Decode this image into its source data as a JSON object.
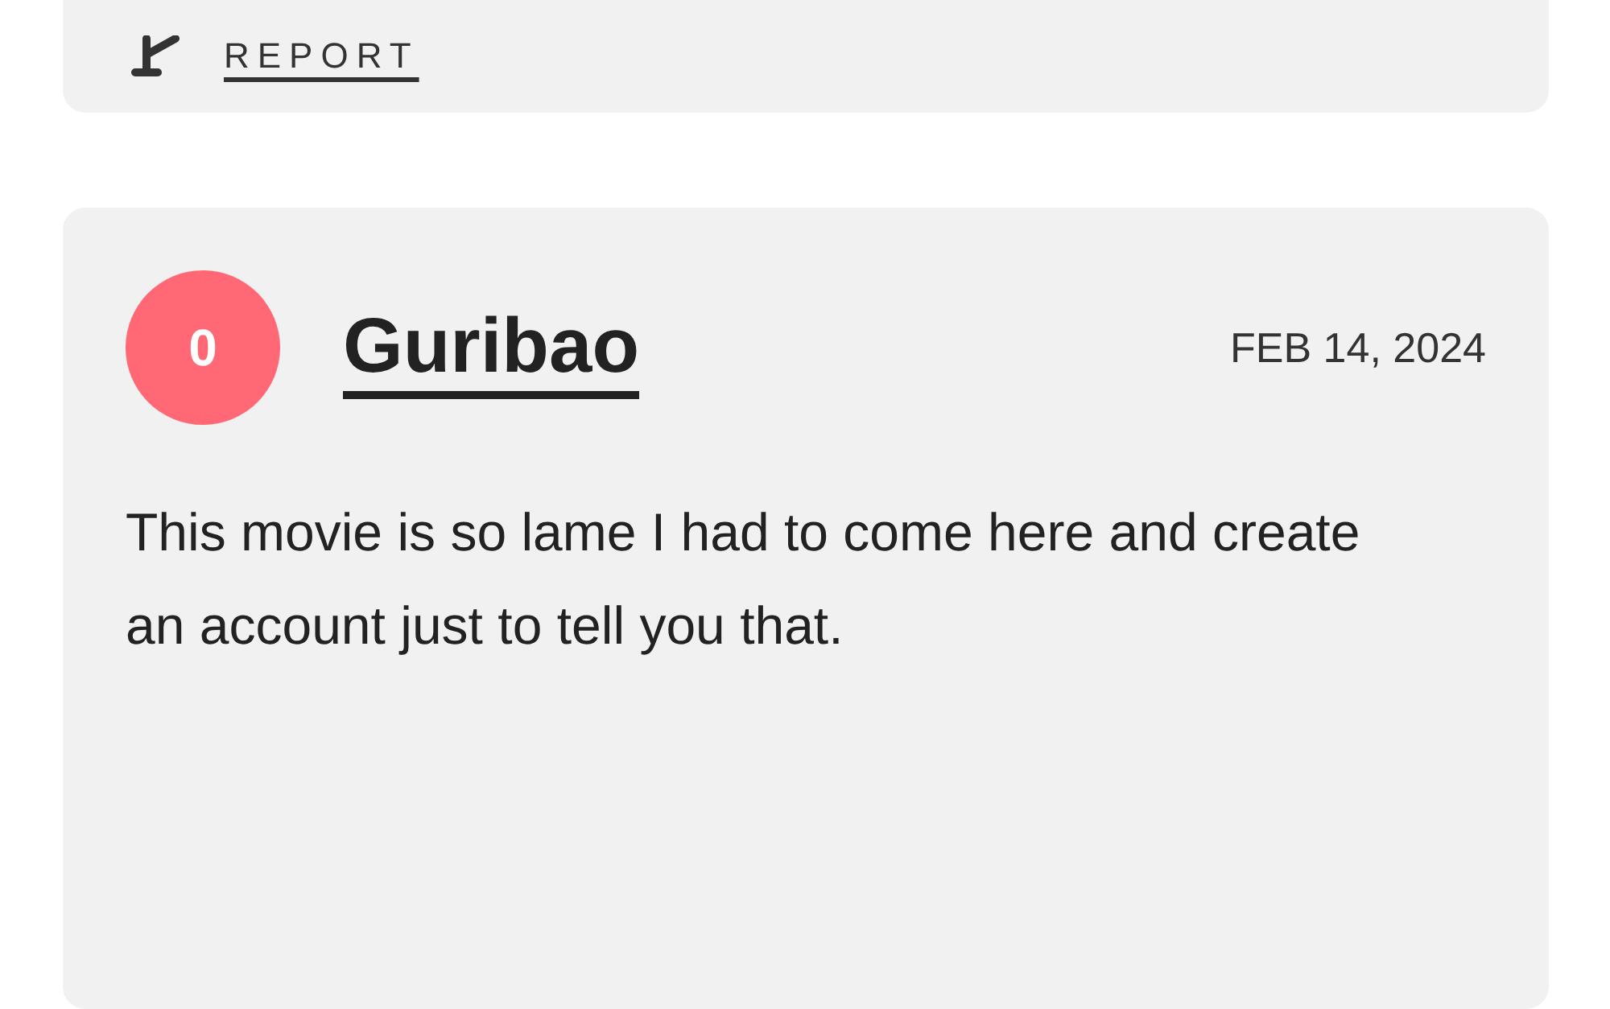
{
  "previous_review": {
    "report_label": "REPORT"
  },
  "review": {
    "score": "0",
    "color": "#ff6874",
    "username": "Guribao",
    "date": "FEB 14, 2024",
    "text": "This movie is so lame I had to come here and create an account just to tell you that."
  }
}
